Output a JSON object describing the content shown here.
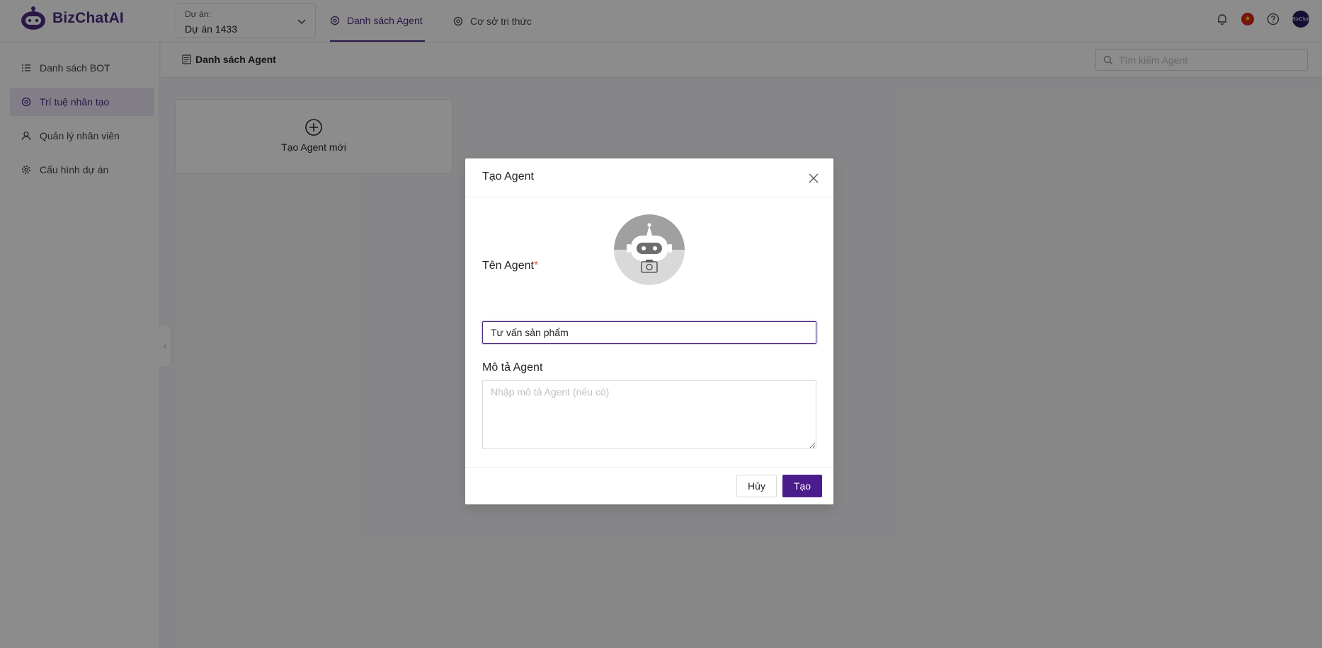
{
  "app": {
    "logo_text": "BizChatAI"
  },
  "header": {
    "project_label": "Dự án:",
    "project_value": "Dự án 1433",
    "tabs": [
      {
        "label": "Danh sách Agent",
        "active": true
      },
      {
        "label": "Cơ sở tri thức",
        "active": false
      }
    ],
    "avatar_text": "BizChat"
  },
  "sidebar": {
    "items": [
      {
        "label": "Danh sách BOT",
        "icon": "list-icon"
      },
      {
        "label": "Trí tuệ nhân tạo",
        "icon": "ai-icon",
        "active": true
      },
      {
        "label": "Quản lý nhân viên",
        "icon": "user-icon"
      },
      {
        "label": "Cấu hình dự án",
        "icon": "gear-icon"
      }
    ]
  },
  "content": {
    "title": "Danh sách Agent",
    "search_placeholder": "Tìm kiếm Agent",
    "new_agent_label": "Tạo Agent mới"
  },
  "modal": {
    "title": "Tạo Agent",
    "name_label": "Tên Agent",
    "name_required": "*",
    "name_value": "Tư vấn sản phẩm",
    "desc_label": "Mô tả Agent",
    "desc_placeholder": "Nhập mô tả Agent (nếu có)",
    "cancel_label": "Hủy",
    "create_label": "Tạo"
  },
  "colors": {
    "brand": "#4b2a82",
    "primary_button": "#4b1d8c",
    "required": "#ff4d4f"
  }
}
